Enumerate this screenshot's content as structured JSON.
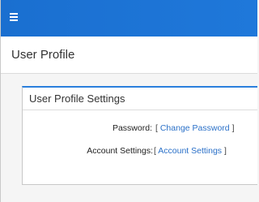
{
  "topbar": {
    "menu_icon": "hamburger-menu-icon",
    "color": "#1c74d6"
  },
  "header": {
    "title": "User Profile"
  },
  "settings_card": {
    "title": "User Profile Settings",
    "accent_color": "#2a7fdc",
    "rows": [
      {
        "label": "Password:",
        "bracket_open": "[",
        "link_text": "Change Password",
        "bracket_close": "]"
      },
      {
        "label": "Account Settings:",
        "bracket_open": "[",
        "link_text": "Account Settings",
        "bracket_close": "]"
      }
    ]
  }
}
